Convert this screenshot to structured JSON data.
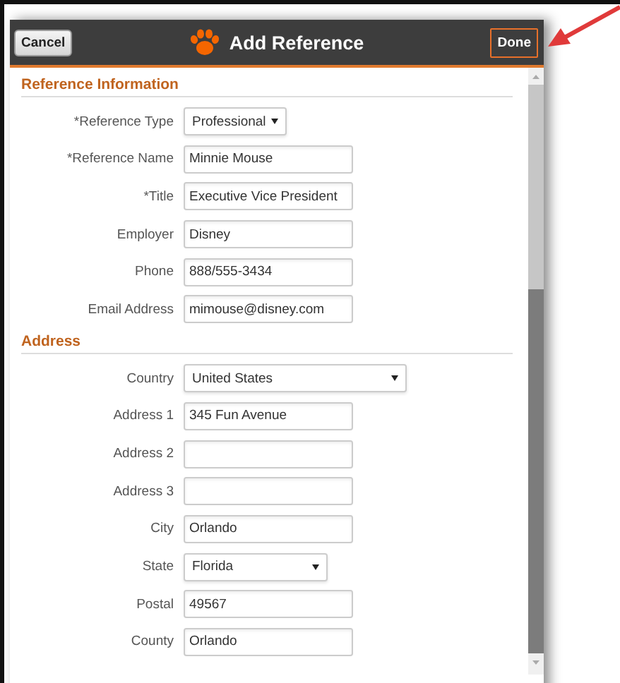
{
  "dialog": {
    "title": "Add Reference",
    "cancel": "Cancel",
    "done": "Done"
  },
  "sections": [
    {
      "title": "Reference Information",
      "fields": [
        {
          "label": "*Reference Type",
          "kind": "select",
          "value": "Professional"
        },
        {
          "label": "*Reference Name",
          "kind": "text",
          "value": "Minnie Mouse"
        },
        {
          "label": "*Title",
          "kind": "text",
          "value": "Executive Vice President"
        },
        {
          "label": "Employer",
          "kind": "text",
          "value": "Disney"
        },
        {
          "label": "Phone",
          "kind": "text",
          "value": "888/555-3434"
        },
        {
          "label": "Email Address",
          "kind": "text",
          "value": "mimouse@disney.com"
        }
      ]
    },
    {
      "title": "Address",
      "fields": [
        {
          "label": "Country",
          "kind": "select",
          "value": "United States"
        },
        {
          "label": "Address 1",
          "kind": "text",
          "value": "345 Fun Avenue"
        },
        {
          "label": "Address 2",
          "kind": "text"
        },
        {
          "label": "Address 3",
          "kind": "text"
        },
        {
          "label": "City",
          "kind": "text",
          "value": "Orlando"
        },
        {
          "label": "State",
          "kind": "select",
          "value": "Florida"
        },
        {
          "label": "Postal",
          "kind": "text",
          "value": "49567"
        },
        {
          "label": "County",
          "kind": "text",
          "value": "Orlando"
        }
      ]
    }
  ]
}
